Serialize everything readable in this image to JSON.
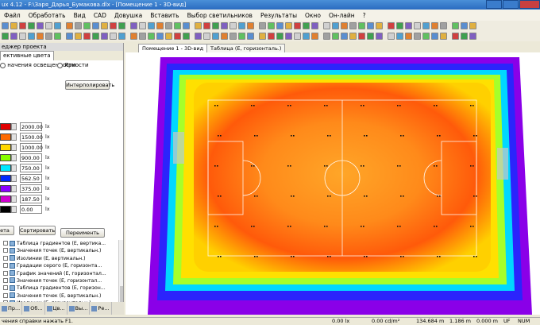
{
  "window": {
    "title": "ux 4.12 - F:\\Заря_Дарья_Бумакова.dlx - [Помещение 1 - 3D-вид]"
  },
  "menu": [
    "Файл",
    "Обработать",
    "Вид",
    "CAD",
    "Довушка",
    "Вставить",
    "Выбор светильников",
    "Результаты",
    "Окно",
    "Он-лайн",
    "?"
  ],
  "panel": {
    "header": "еджер проекта",
    "tab": "ективные цвета",
    "visibility_label": "начения освещенности",
    "brightness_label": "Яркости",
    "interpolate_button": "Интерполировать",
    "levels": [
      {
        "color": "#e00000",
        "value": "2000.00",
        "unit": "lx"
      },
      {
        "color": "#ff6a00",
        "value": "1500.00",
        "unit": "lx"
      },
      {
        "color": "#ffd800",
        "value": "1000.00",
        "unit": "lx"
      },
      {
        "color": "#88ff00",
        "value": "900.00",
        "unit": "lx"
      },
      {
        "color": "#00e8ff",
        "value": "750.00",
        "unit": "lx"
      },
      {
        "color": "#0028ff",
        "value": "562.50",
        "unit": "lx"
      },
      {
        "color": "#8a00ff",
        "value": "375.00",
        "unit": "lx"
      },
      {
        "color": "#d000d0",
        "value": "187.50",
        "unit": "lx"
      },
      {
        "color": "#000000",
        "value": "0.00",
        "unit": "lx"
      }
    ],
    "buttons": {
      "left": "ета",
      "sort": "Сортировать",
      "rename": "Переименть"
    }
  },
  "tree": [
    "Таблица градиентов (E, вертика...",
    "Значения точек (E, вертикальн.)",
    "Изолинии (E, вертикальн.)",
    "Градации серого (E, горизонта...",
    "График значений (E, горизонтал...",
    "Значения точек (E, горизонтал...",
    "Таблица градиентов (E, горизон...",
    "Значения точек (E, вертикальн.)",
    "Изолинии (E, горизонтальн.)",
    "Градации серого (E, вертикальн...",
    "График значений (E, вертикальн...",
    "Таблица (E, горизонтальн.)"
  ],
  "bottom_tabs": [
    "Пр...",
    "Об...",
    "Цв...",
    "Вы...",
    "Ре..."
  ],
  "doc_tabs": [
    "Помещение 1 - 3D-вид",
    "Таблица (E, горизонталь.)"
  ],
  "status": {
    "help": "чения справки нажать F1.",
    "illuminance": "0.00 lx",
    "luminance": "0.00 cd/m²",
    "x": "134.684 m",
    "y": "1.186 m",
    "z": "0.000 m",
    "uf": "UF",
    "num": "NUM"
  }
}
